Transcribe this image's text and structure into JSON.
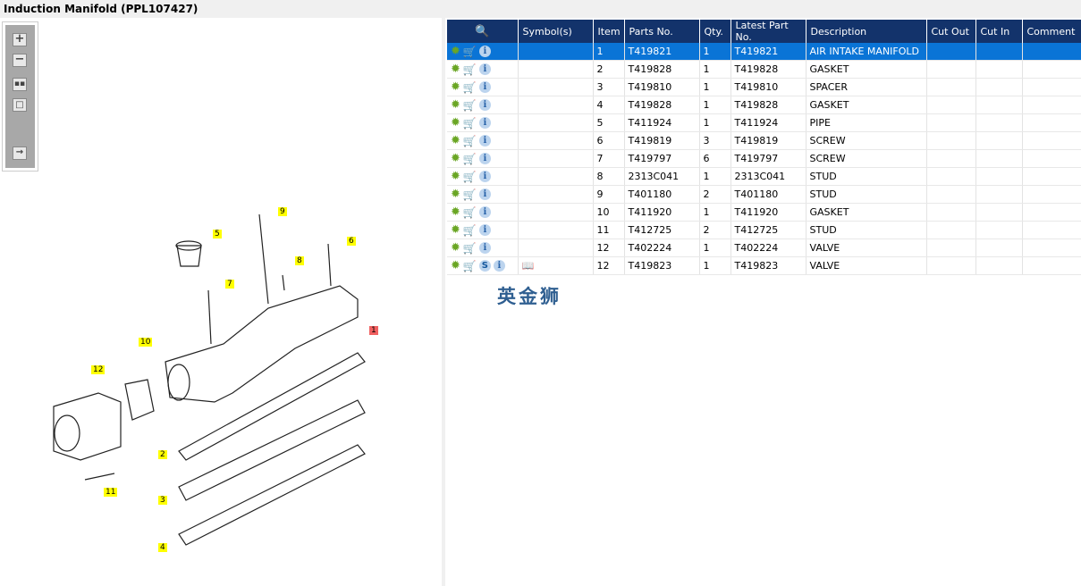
{
  "title": "Induction Manifold (PPL107427)",
  "toolbar": {
    "zoom_in": "+",
    "zoom_out": "−"
  },
  "table": {
    "columns": [
      "",
      "Symbol(s)",
      "Item",
      "Parts No.",
      "Qty.",
      "Latest Part No.",
      "Description",
      "Cut Out",
      "Cut In",
      "Comment"
    ],
    "rows": [
      {
        "item": "1",
        "part": "T419821",
        "qty": "1",
        "latest": "T419821",
        "desc": "AIR INTAKE MANIFOLD",
        "selected": true
      },
      {
        "item": "2",
        "part": "T419828",
        "qty": "1",
        "latest": "T419828",
        "desc": "GASKET"
      },
      {
        "item": "3",
        "part": "T419810",
        "qty": "1",
        "latest": "T419810",
        "desc": "SPACER"
      },
      {
        "item": "4",
        "part": "T419828",
        "qty": "1",
        "latest": "T419828",
        "desc": "GASKET"
      },
      {
        "item": "5",
        "part": "T411924",
        "qty": "1",
        "latest": "T411924",
        "desc": "PIPE"
      },
      {
        "item": "6",
        "part": "T419819",
        "qty": "3",
        "latest": "T419819",
        "desc": "SCREW"
      },
      {
        "item": "7",
        "part": "T419797",
        "qty": "6",
        "latest": "T419797",
        "desc": "SCREW"
      },
      {
        "item": "8",
        "part": "2313C041",
        "qty": "1",
        "latest": "2313C041",
        "desc": "STUD"
      },
      {
        "item": "9",
        "part": "T401180",
        "qty": "2",
        "latest": "T401180",
        "desc": "STUD"
      },
      {
        "item": "10",
        "part": "T411920",
        "qty": "1",
        "latest": "T411920",
        "desc": "GASKET"
      },
      {
        "item": "11",
        "part": "T412725",
        "qty": "2",
        "latest": "T412725",
        "desc": "STUD"
      },
      {
        "item": "12",
        "part": "T402224",
        "qty": "1",
        "latest": "T402224",
        "desc": "VALVE"
      },
      {
        "item": "12",
        "part": "T419823",
        "qty": "1",
        "latest": "T419823",
        "desc": "VALVE",
        "s_badge": "S",
        "symbol": "book"
      }
    ]
  },
  "watermark": "英金狮",
  "callouts": [
    "1",
    "2",
    "3",
    "4",
    "5",
    "6",
    "7",
    "8",
    "9",
    "10",
    "11",
    "12"
  ],
  "colors": {
    "header": "#13336b",
    "selected": "#0a74d6",
    "callout": "#ffff00",
    "callout_active": "#f06060"
  }
}
